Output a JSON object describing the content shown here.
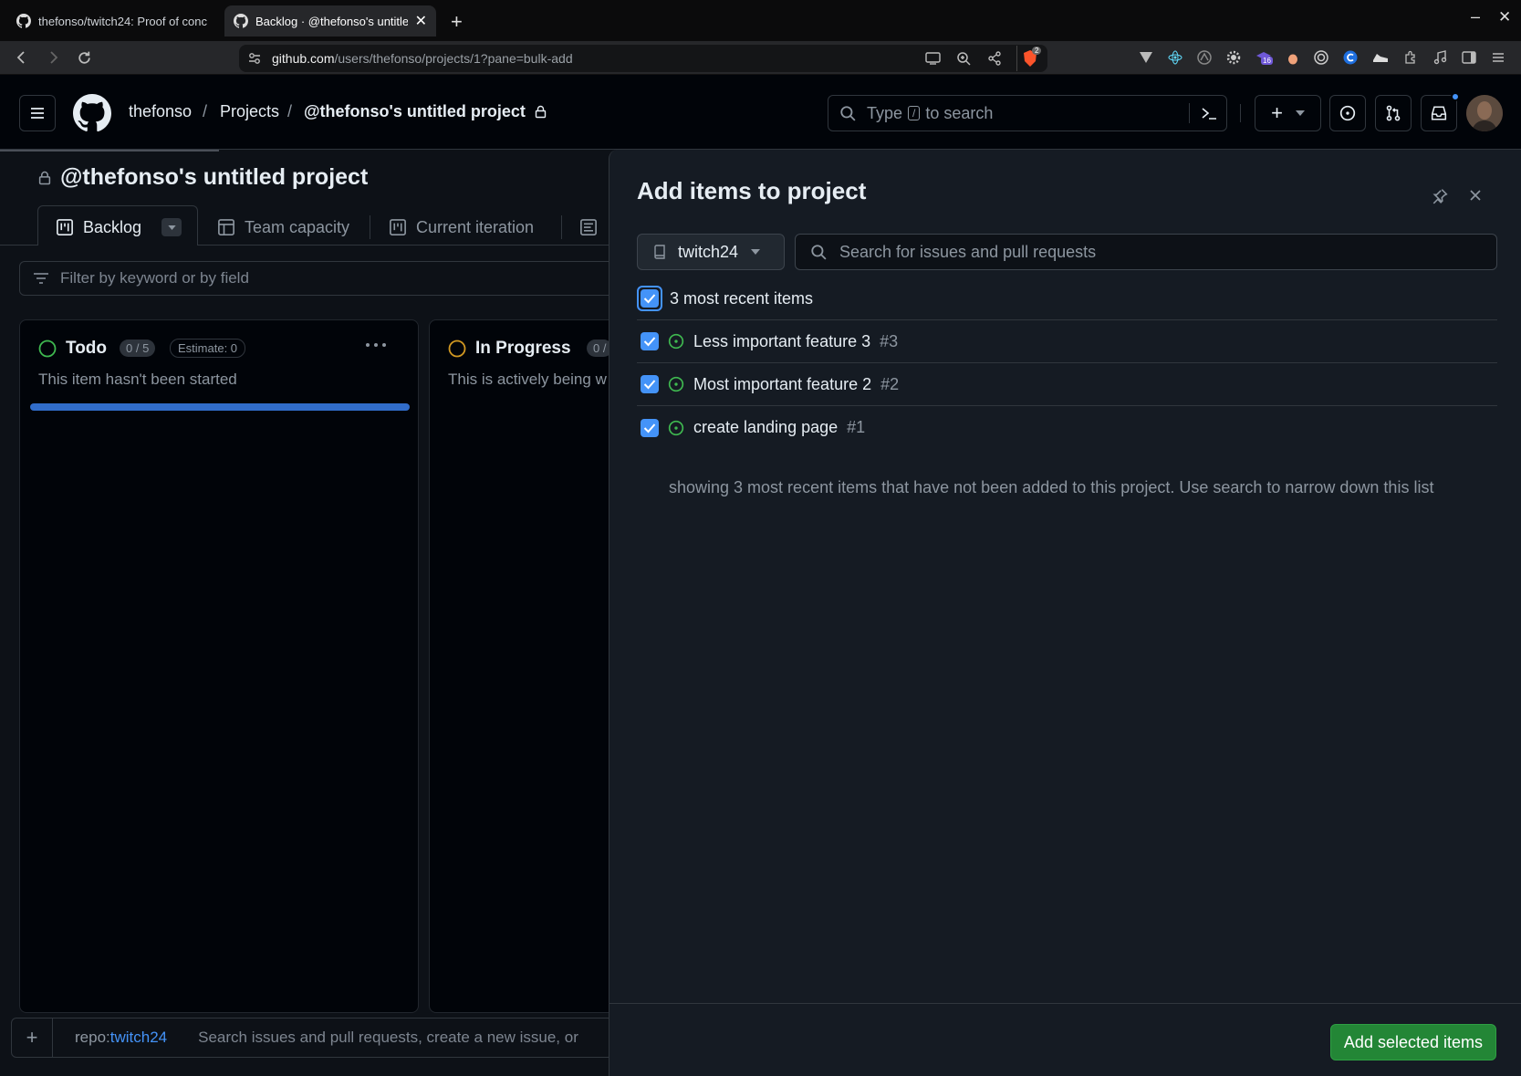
{
  "browser": {
    "tabs": [
      {
        "title": "thefonso/twitch24: Proof of conc",
        "active": false
      },
      {
        "title": "Backlog · @thefonso's untitled",
        "active": true
      }
    ],
    "url_host": "github.com",
    "url_path": "/users/thefonso/projects/1?pane=bulk-add",
    "extension_badges": {
      "brave": "2",
      "ext": "16"
    }
  },
  "header": {
    "breadcrumb": {
      "owner": "thefonso",
      "section": "Projects",
      "project": "@thefonso's untitled project"
    },
    "search": {
      "prefix": "Type",
      "key": "/",
      "suffix": "to search"
    }
  },
  "project": {
    "title": "@thefonso's untitled project",
    "tabs": [
      {
        "label": "Backlog",
        "active": true
      },
      {
        "label": "Team capacity",
        "active": false
      },
      {
        "label": "Current iteration",
        "active": false
      }
    ],
    "filter_placeholder": "Filter by keyword or by field",
    "columns": [
      {
        "name": "Todo",
        "count": "0 / 5",
        "estimate": "Estimate: 0",
        "description": "This item hasn't been started",
        "status_color": "#3fb950"
      },
      {
        "name": "In Progress",
        "count": "0 /",
        "description": "This is actively being w",
        "status_color": "#d29922"
      }
    ],
    "add_bar": {
      "prefix": "repo:",
      "repo": "twitch24",
      "placeholder": "Search issues and pull requests, create a new issue, or"
    }
  },
  "pane": {
    "title": "Add items to project",
    "repo_selector": "twitch24",
    "search_placeholder": "Search for issues and pull requests",
    "select_all_label": "3 most recent items",
    "items": [
      {
        "title": "Less important feature 3",
        "number": "#3",
        "checked": true
      },
      {
        "title": "Most important feature 2",
        "number": "#2",
        "checked": true
      },
      {
        "title": "create landing page",
        "number": "#1",
        "checked": true
      }
    ],
    "note": "showing 3 most recent items that have not been added to this project. Use search to narrow down this list",
    "add_button": "Add selected items"
  },
  "colors": {
    "accent": "#4493f8",
    "green": "#238636",
    "open_issue": "#3fb950"
  }
}
